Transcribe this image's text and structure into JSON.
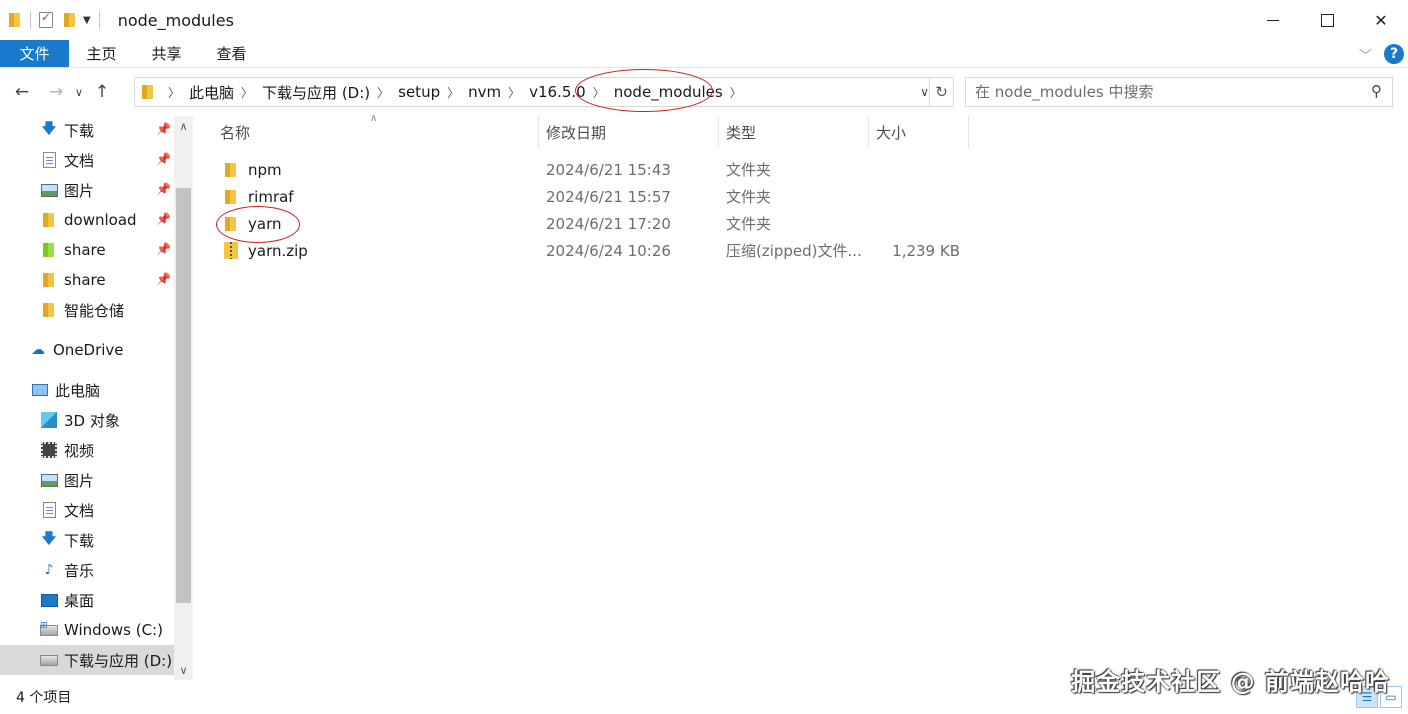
{
  "window": {
    "title": "node_modules"
  },
  "ribbon": {
    "tabs": [
      "文件",
      "主页",
      "共享",
      "查看"
    ],
    "help": "?"
  },
  "address": {
    "crumbs": [
      "此电脑",
      "下载与应用 (D:)",
      "setup",
      "nvm",
      "v16.5.0",
      "node_modules"
    ]
  },
  "search": {
    "placeholder": "在 node_modules 中搜索"
  },
  "sidebar": {
    "quick_access": [
      {
        "label": "下载",
        "icon": "download-arrow-icon",
        "pinned": true
      },
      {
        "label": "文档",
        "icon": "document-icon",
        "pinned": true
      },
      {
        "label": "图片",
        "icon": "picture-icon",
        "pinned": true
      },
      {
        "label": "download",
        "icon": "folder-icon",
        "pinned": true
      },
      {
        "label": "share",
        "icon": "shared-folder-icon",
        "pinned": true
      },
      {
        "label": "share",
        "icon": "folder-icon",
        "pinned": true
      },
      {
        "label": "智能仓储",
        "icon": "folder-icon",
        "pinned": false
      }
    ],
    "onedrive": "OneDrive",
    "this_pc": "此电脑",
    "pc_items": [
      {
        "label": "3D 对象",
        "icon": "3d-objects-icon"
      },
      {
        "label": "视频",
        "icon": "video-icon"
      },
      {
        "label": "图片",
        "icon": "picture-icon"
      },
      {
        "label": "文档",
        "icon": "document-icon"
      },
      {
        "label": "下载",
        "icon": "download-arrow-icon"
      },
      {
        "label": "音乐",
        "icon": "music-icon"
      },
      {
        "label": "桌面",
        "icon": "desktop-icon"
      },
      {
        "label": "Windows (C:)",
        "icon": "windows-drive-icon"
      },
      {
        "label": "下载与应用 (D:)",
        "icon": "drive-icon",
        "selected": true
      }
    ]
  },
  "columns": {
    "name": "名称",
    "modified": "修改日期",
    "type": "类型",
    "size": "大小"
  },
  "files": [
    {
      "name": "npm",
      "modified": "2024/6/21 15:43",
      "type": "文件夹",
      "size": "",
      "icon": "folder-icon"
    },
    {
      "name": "rimraf",
      "modified": "2024/6/21 15:57",
      "type": "文件夹",
      "size": "",
      "icon": "folder-icon"
    },
    {
      "name": "yarn",
      "modified": "2024/6/21 17:20",
      "type": "文件夹",
      "size": "",
      "icon": "folder-icon"
    },
    {
      "name": "yarn.zip",
      "modified": "2024/6/24 10:26",
      "type": "压缩(zipped)文件...",
      "size": "1,239 KB",
      "icon": "zip-folder-icon"
    }
  ],
  "status": {
    "count": "4 个项目"
  },
  "watermark": "掘金技术社区 @ 前端赵哈哈",
  "colors": {
    "accent": "#1979ca",
    "annotation": "#d11d1d",
    "folder": "#f4c542"
  }
}
